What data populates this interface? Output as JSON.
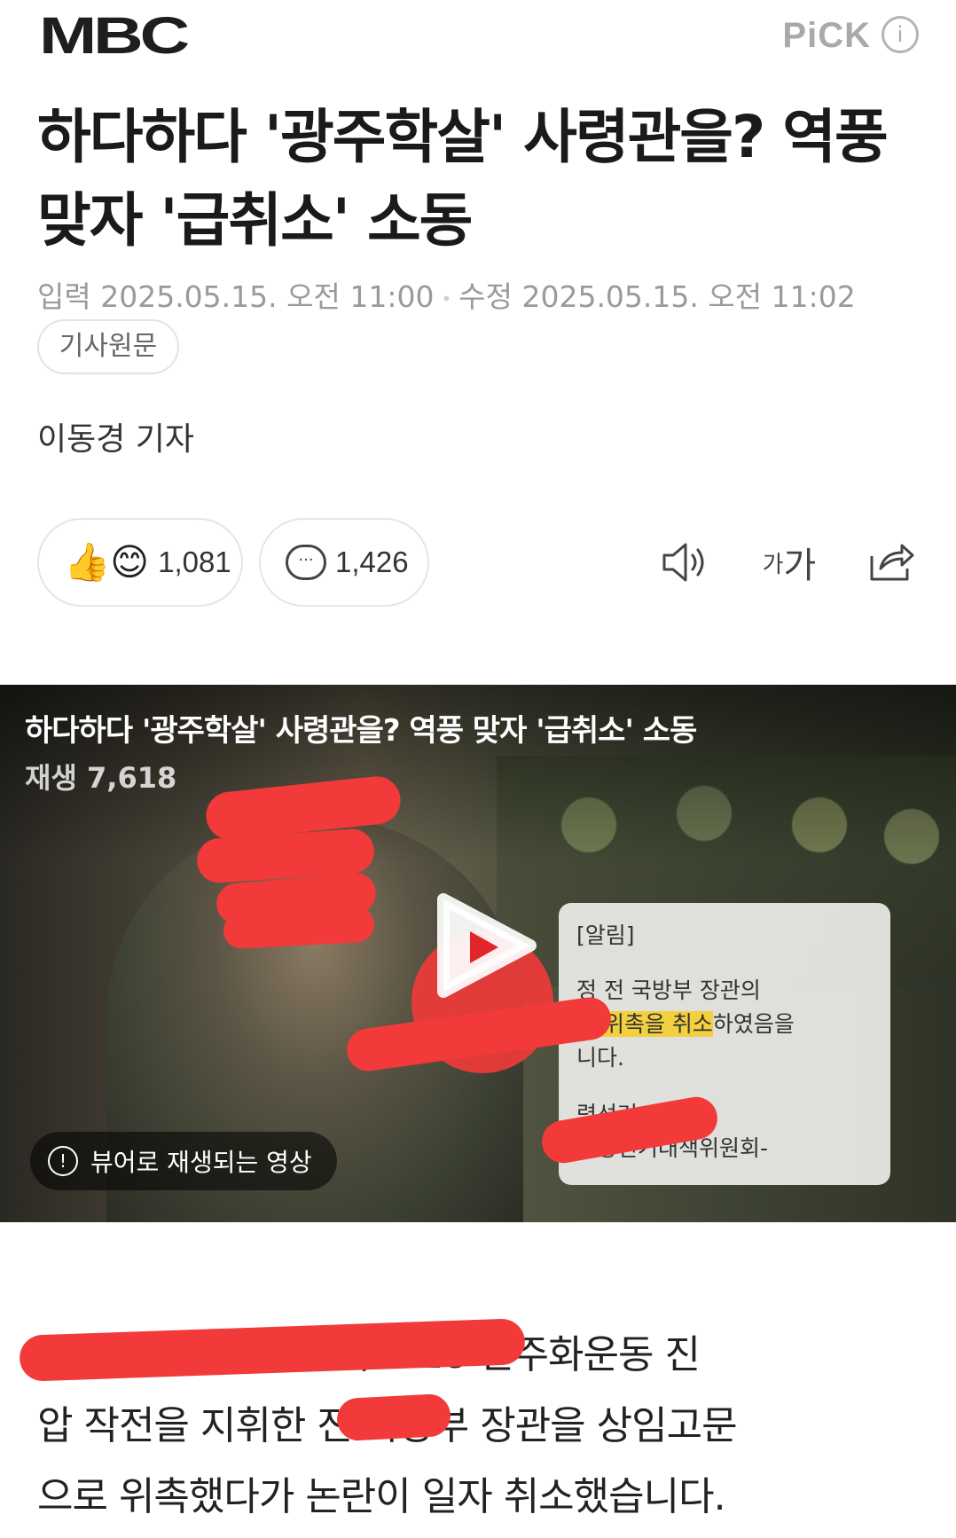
{
  "header": {
    "logo": "MBC",
    "pick": "PiCK",
    "info_icon": "i"
  },
  "article": {
    "title": "하다하다 '광주학살' 사령관을? 역풍 맞자 '급취소' 소동",
    "dates": {
      "input": "입력 2025.05.15. 오전 11:00",
      "edit": "수정 2025.05.15. 오전 11:02"
    },
    "original_button": "기사원문",
    "reporter": "이동경 기자"
  },
  "reactions": {
    "like_emoji": "👍😊",
    "like_count": "1,081",
    "comment_count": "1,426"
  },
  "tools": {
    "font_label": "가",
    "font_label_large": "가"
  },
  "video": {
    "title": "하다하다 '광주학살' 사령관을? 역풍 맞자 '급취소' 소동",
    "views": "재생 7,618",
    "notice_title": "[알림]",
    "notice_line1": "정      전 국방부 장관의",
    "notice_line2_highlight": "문 위촉을 취소",
    "notice_line2_rest": "하였음을",
    "notice_line3": "니다.",
    "notice_line4": "령선거",
    "notice_line5": "중앙선거대책위원회-",
    "badge": "뷰어로 재생되는 영상"
  },
  "body": {
    "line1": "                          가 5·18 민주화운동 진",
    "line2": "압 작전을 지휘한 전 국방부 장관을 상임고문",
    "line3": "으로 위촉했다가 논란이 일자 취소했습니다."
  },
  "colors": {
    "scribble": "#f23a3a",
    "highlight": "#f3d03e"
  }
}
